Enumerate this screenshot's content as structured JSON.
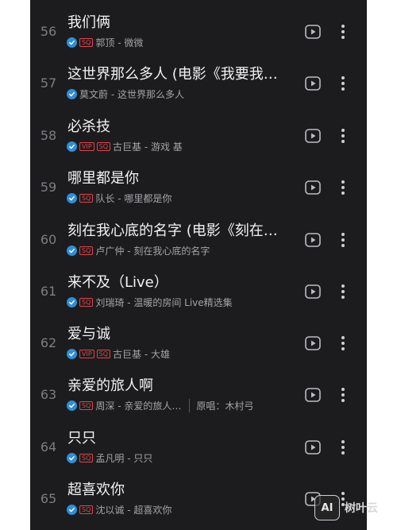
{
  "songs": [
    {
      "num": "56",
      "title": "我们俩",
      "vip": false,
      "sq": true,
      "artist": "郭顶 - 微微",
      "original": ""
    },
    {
      "num": "57",
      "title": "这世界那么多人 (电影《我要我们在一起》主题曲)",
      "vip": false,
      "sq": false,
      "artist": "莫文蔚 - 这世界那么多人",
      "original": ""
    },
    {
      "num": "58",
      "title": "必杀技",
      "vip": true,
      "sq": true,
      "artist": "古巨基 - 游戏 基",
      "original": ""
    },
    {
      "num": "59",
      "title": "哪里都是你",
      "vip": false,
      "sq": true,
      "artist": "队长 - 哪里都是你",
      "original": ""
    },
    {
      "num": "60",
      "title": "刻在我心底的名字 (电影《刻在你心底的名字》主题曲)",
      "vip": false,
      "sq": true,
      "artist": "卢广仲 - 刻在我心底的名字",
      "original": ""
    },
    {
      "num": "61",
      "title": "来不及（Live）",
      "vip": false,
      "sq": true,
      "artist": "刘瑞琦 - 温暖的房间 Live精选集",
      "original": ""
    },
    {
      "num": "62",
      "title": "爱与诚",
      "vip": true,
      "sq": true,
      "artist": "古巨基 - 大雄",
      "original": ""
    },
    {
      "num": "63",
      "title": "亲爱的旅人啊",
      "vip": false,
      "sq": true,
      "artist": "周深 - 亲爱的旅人…",
      "original": "原唱：木村弓"
    },
    {
      "num": "64",
      "title": "只只",
      "vip": false,
      "sq": true,
      "artist": "孟凡明 - 只只",
      "original": ""
    },
    {
      "num": "65",
      "title": "超喜欢你",
      "vip": false,
      "sq": true,
      "artist": "沈以诚 - 超喜欢你",
      "original": ""
    }
  ],
  "badges": {
    "vip": "VIP",
    "sq": "SQ"
  },
  "watermark": {
    "logo": "AI",
    "text": "树叶云"
  },
  "colors": {
    "background": "#1c1c1e",
    "badge": "#e0454b",
    "check": "#2e8fd8"
  }
}
